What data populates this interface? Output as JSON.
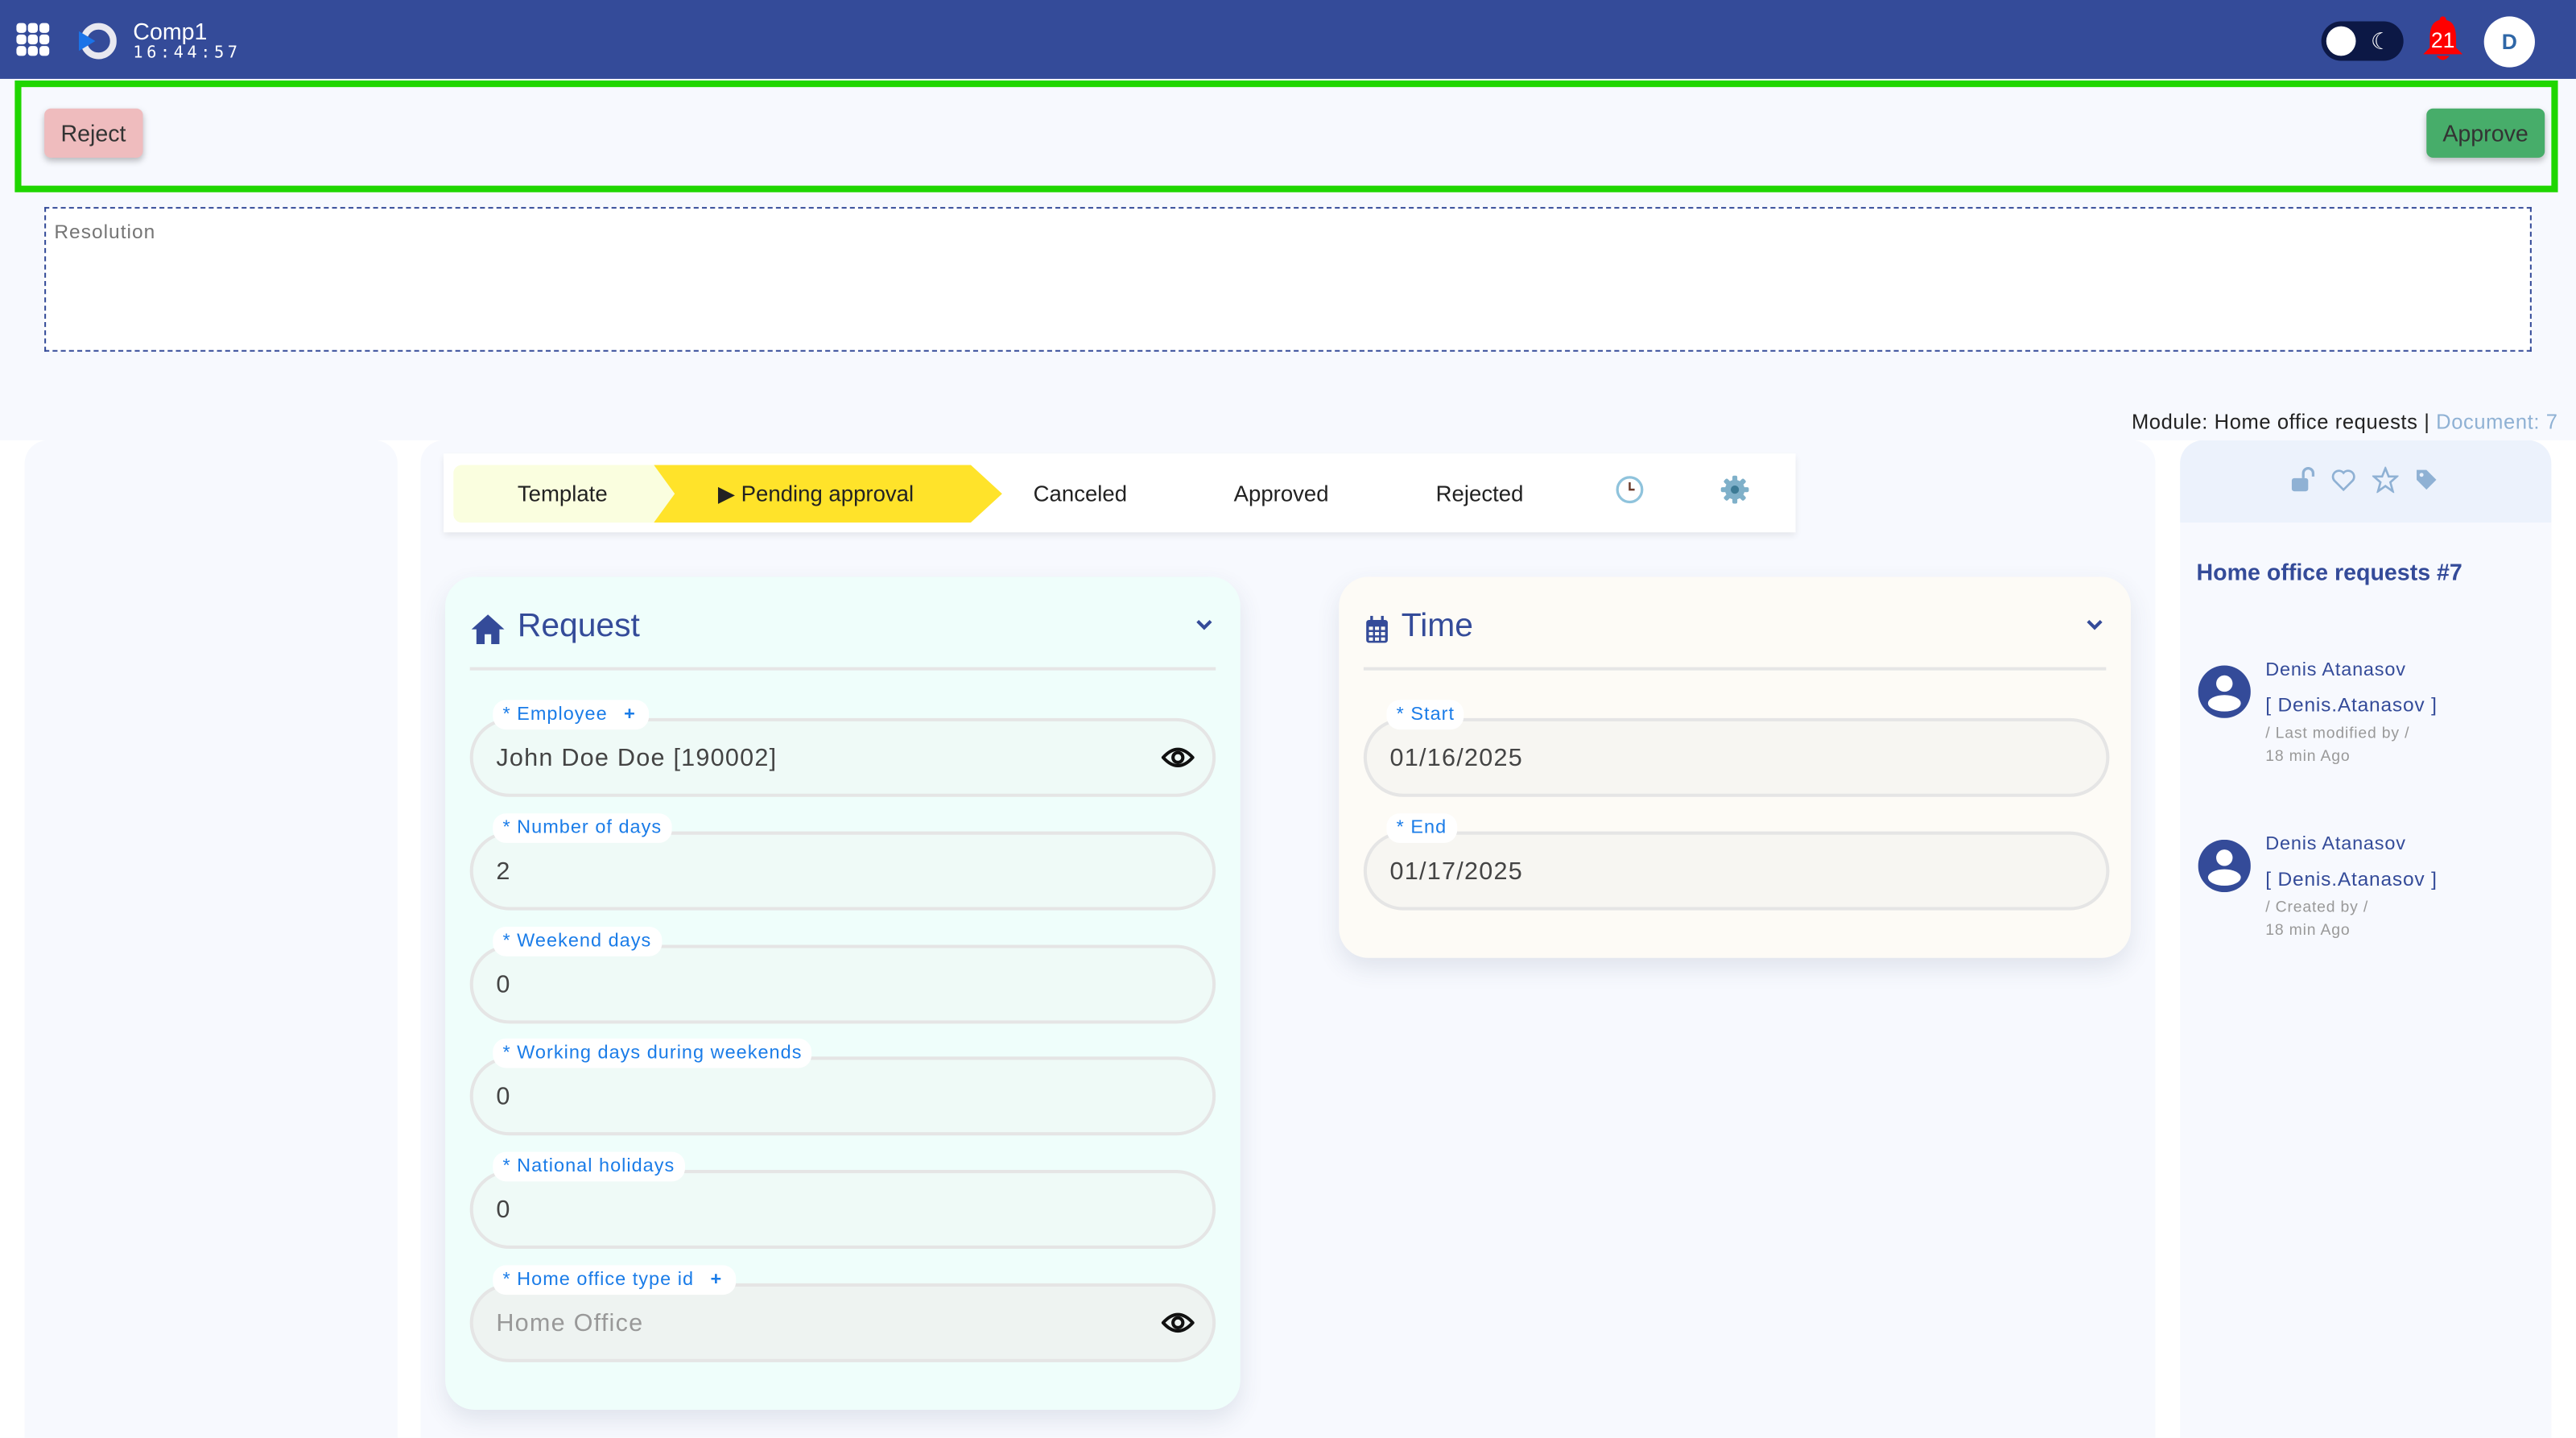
{
  "app": {
    "company": "Comp1",
    "clock": "16:44:57",
    "notification_count": "21",
    "user_initial": "D",
    "colors": {
      "topbar": "#344b99",
      "accent": "#344b99",
      "highlight": "#1fd600",
      "notification": "#ff0000"
    }
  },
  "actions": {
    "reject_label": "Reject",
    "approve_label": "Approve",
    "resolution_placeholder": "Resolution",
    "resolution_value": ""
  },
  "module_info": {
    "module": "Module: Home office requests |",
    "document": "Document: 7"
  },
  "stepper": {
    "steps": [
      {
        "label": "Template",
        "state": "done"
      },
      {
        "label": "▶ Pending approval",
        "state": "current"
      },
      {
        "label": "Canceled",
        "state": "pending"
      },
      {
        "label": "Approved",
        "state": "pending"
      },
      {
        "label": "Rejected",
        "state": "pending"
      }
    ],
    "icons": [
      "history-icon",
      "settings-icon"
    ]
  },
  "request_card": {
    "title": "Request",
    "icon": "home-icon",
    "fields": [
      {
        "label": "* Employee",
        "has_add": true,
        "value": "John Doe Doe [190002]",
        "has_view": true
      },
      {
        "label": "* Number of days",
        "value": "2"
      },
      {
        "label": "* Weekend days",
        "value": "0"
      },
      {
        "label": "* Working days during weekends",
        "value": "0"
      },
      {
        "label": "* National holidays",
        "value": "0"
      },
      {
        "label": "* Home office type id",
        "has_add": true,
        "value": "Home Office",
        "has_view": true,
        "disabled": true
      }
    ],
    "add_symbol": "+"
  },
  "time_card": {
    "title": "Time",
    "icon": "calendar-icon",
    "fields": [
      {
        "label": "* Start",
        "value": "01/16/2025"
      },
      {
        "label": "* End",
        "value": "01/17/2025"
      }
    ]
  },
  "sidebar": {
    "title": "Home office requests #7",
    "icons": [
      "unlock-icon",
      "heart-icon",
      "star-icon",
      "tag-icon"
    ],
    "audit": [
      {
        "name": "Denis Atanasov",
        "username": "[ Denis.Atanasov ]",
        "action": "/ Last modified by /",
        "time": "18 min Ago"
      },
      {
        "name": "Denis Atanasov",
        "username": "[ Denis.Atanasov ]",
        "action": "/ Created by /",
        "time": "18 min Ago"
      }
    ]
  }
}
